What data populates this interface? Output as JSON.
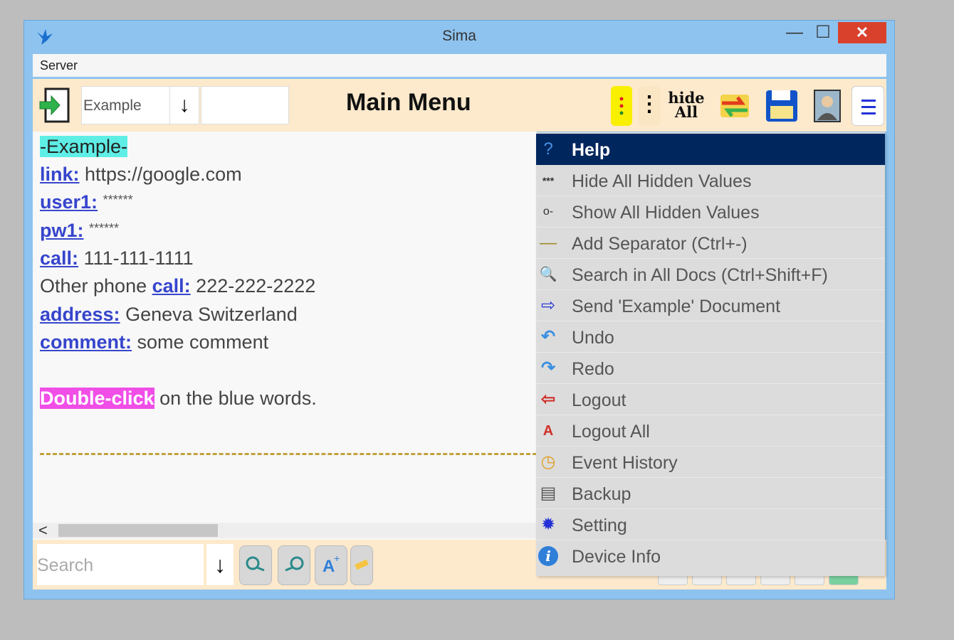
{
  "window": {
    "title": "Sima",
    "minimize_glyph": "—",
    "maximize_glyph": "☐",
    "close_glyph": "✕"
  },
  "menubar": {
    "items": [
      "Server"
    ]
  },
  "toolbar": {
    "document_select": "Example",
    "down_arrow": "↓",
    "title": "Main Menu",
    "yellow_dots": "⋮",
    "more_dots": "⋮",
    "hide_all_line1": "hide",
    "hide_all_line2": "All",
    "menu_glyph": "≡"
  },
  "document": {
    "title": "-Example-",
    "fields": [
      {
        "label": "link:",
        "value": "https://google.com"
      },
      {
        "label": "user1:",
        "value": "******"
      },
      {
        "label": "pw1:",
        "value": "******"
      },
      {
        "label": "call:",
        "value": "111-111-1111"
      }
    ],
    "other_phone_prefix": "Other phone",
    "other_phone_label": "call:",
    "other_phone_value": "222-222-2222",
    "address_label": "address:",
    "address_value": "Geneva Switzerland",
    "comment_label": "comment:",
    "comment_value": "some comment",
    "hint_highlight": "Double-click",
    "hint_rest": "on the blue words."
  },
  "scroll": {
    "left_glyph": "<"
  },
  "statusbar": {
    "search_placeholder": "Search",
    "search_arrow": "↓"
  },
  "dropdown": {
    "items": [
      {
        "label": "Help",
        "icon": "?",
        "active": true
      },
      {
        "label": "Hide All Hidden Values",
        "icon": "***"
      },
      {
        "label": "Show All Hidden Values",
        "icon": "o-"
      },
      {
        "label": "Add Separator (Ctrl+-)",
        "icon": "—"
      },
      {
        "label": "Search in All Docs (Ctrl+Shift+F)",
        "icon": "🔍"
      },
      {
        "label": "Send 'Example' Document",
        "icon": "⇨"
      },
      {
        "label": "Undo",
        "icon": "↶"
      },
      {
        "label": "Redo",
        "icon": "↷"
      },
      {
        "label": "Logout",
        "icon": "⇦"
      },
      {
        "label": "Logout All",
        "icon": "A"
      },
      {
        "label": "Event History",
        "icon": "◷"
      },
      {
        "label": "Backup",
        "icon": "▤"
      },
      {
        "label": "Setting",
        "icon": "✹"
      },
      {
        "label": "Device Info",
        "icon": "i"
      }
    ]
  },
  "colors": {
    "accent": "#00265e",
    "window_frame": "#8ec3ef",
    "toolbar_bg": "#fde9cc",
    "link": "#3645cc"
  }
}
